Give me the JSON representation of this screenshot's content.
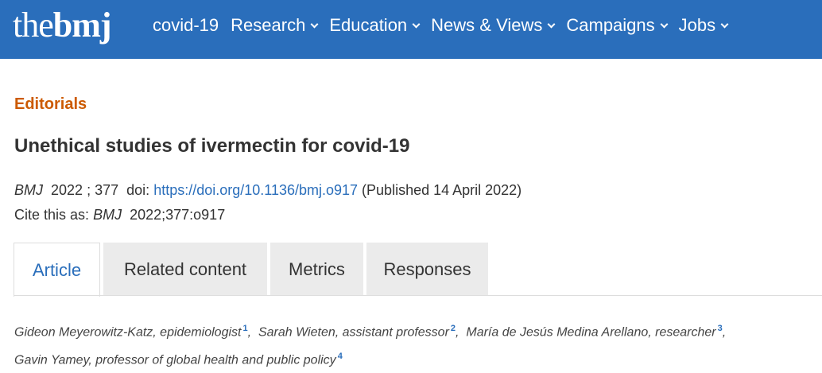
{
  "header": {
    "logo_the": "the",
    "logo_bmj": "bmj",
    "nav": [
      {
        "label": "covid-19",
        "dropdown": false
      },
      {
        "label": "Research",
        "dropdown": true
      },
      {
        "label": "Education",
        "dropdown": true
      },
      {
        "label": "News & Views",
        "dropdown": true
      },
      {
        "label": "Campaigns",
        "dropdown": true
      },
      {
        "label": "Jobs",
        "dropdown": true
      }
    ],
    "colors": {
      "bar": "#2a6ebb",
      "text": "#ffffff"
    }
  },
  "article": {
    "section": "Editorials",
    "title": "Unethical studies of ivermectin for covid-19",
    "journal": "BMJ",
    "year": "2022",
    "volume": "377",
    "doi_label": "doi:",
    "doi_link": "https://doi.org/10.1136/bmj.o917",
    "published": "(Published 14 April 2022)",
    "cite_prefix": "Cite this as:",
    "cite_value": "2022;377:o917"
  },
  "tabs": [
    {
      "label": "Article",
      "active": true
    },
    {
      "label": "Related content",
      "active": false
    },
    {
      "label": "Metrics",
      "active": false
    },
    {
      "label": "Responses",
      "active": false
    }
  ],
  "authors": [
    {
      "name": "Gideon Meyerowitz-Katz, epidemiologist",
      "affil": "1"
    },
    {
      "name": "Sarah Wieten, assistant professor",
      "affil": "2"
    },
    {
      "name": "María de Jesús Medina Arellano, researcher",
      "affil": "3"
    },
    {
      "name": "Gavin Yamey, professor of global health and public policy",
      "affil": "4"
    }
  ],
  "colors": {
    "section": "#cc5a00",
    "link": "#2a6ebb",
    "tab_bg": "#ebebeb"
  }
}
